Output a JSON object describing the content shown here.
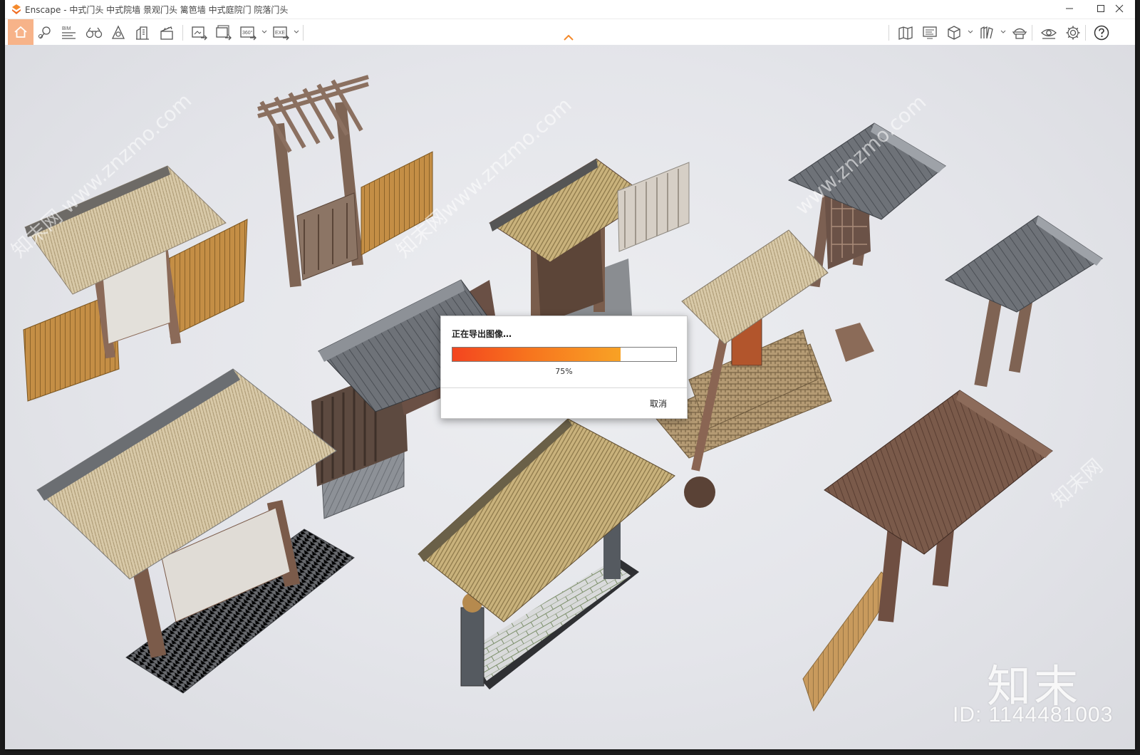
{
  "window": {
    "title": "Enscape - 中式门头 中式院墙 景观门头 篱笆墙 中式庭院门 院落门头",
    "controls": [
      "minimize-icon",
      "maximize-icon",
      "close-icon"
    ]
  },
  "toolbar": {
    "left_icons": [
      "home-icon",
      "location-pin-icon",
      "bim-icon",
      "binoculars-icon",
      "light-view-icon",
      "building-icon",
      "clapper-icon",
      "screenshot-export-icon",
      "batch-export-icon",
      "panorama-360-icon",
      "exe-export-icon"
    ],
    "bim_label": "BIM",
    "pano_label": "360°",
    "exe_label": "EXE",
    "right_icons": [
      "map-icon",
      "monitor-icon",
      "cube-icon",
      "library-icon",
      "asset-hat-icon",
      "eye-icon",
      "gear-icon",
      "help-icon"
    ]
  },
  "dialog": {
    "title": "正在导出图像…",
    "progress": 0.75,
    "percent_label": "75%",
    "cancel_label": "取消"
  },
  "watermarks": {
    "brand": "知末",
    "id": "ID: 1144481003",
    "diagonal": [
      "知末网 www.znzmo.com",
      "知末网www.znzmo.com",
      "www.znzmo.com",
      "知末网"
    ]
  },
  "colors": {
    "accent": "#f48a2c",
    "home_highlight": "#f7b389",
    "progress_start": "#f3451f",
    "progress_end": "#f8a225"
  }
}
